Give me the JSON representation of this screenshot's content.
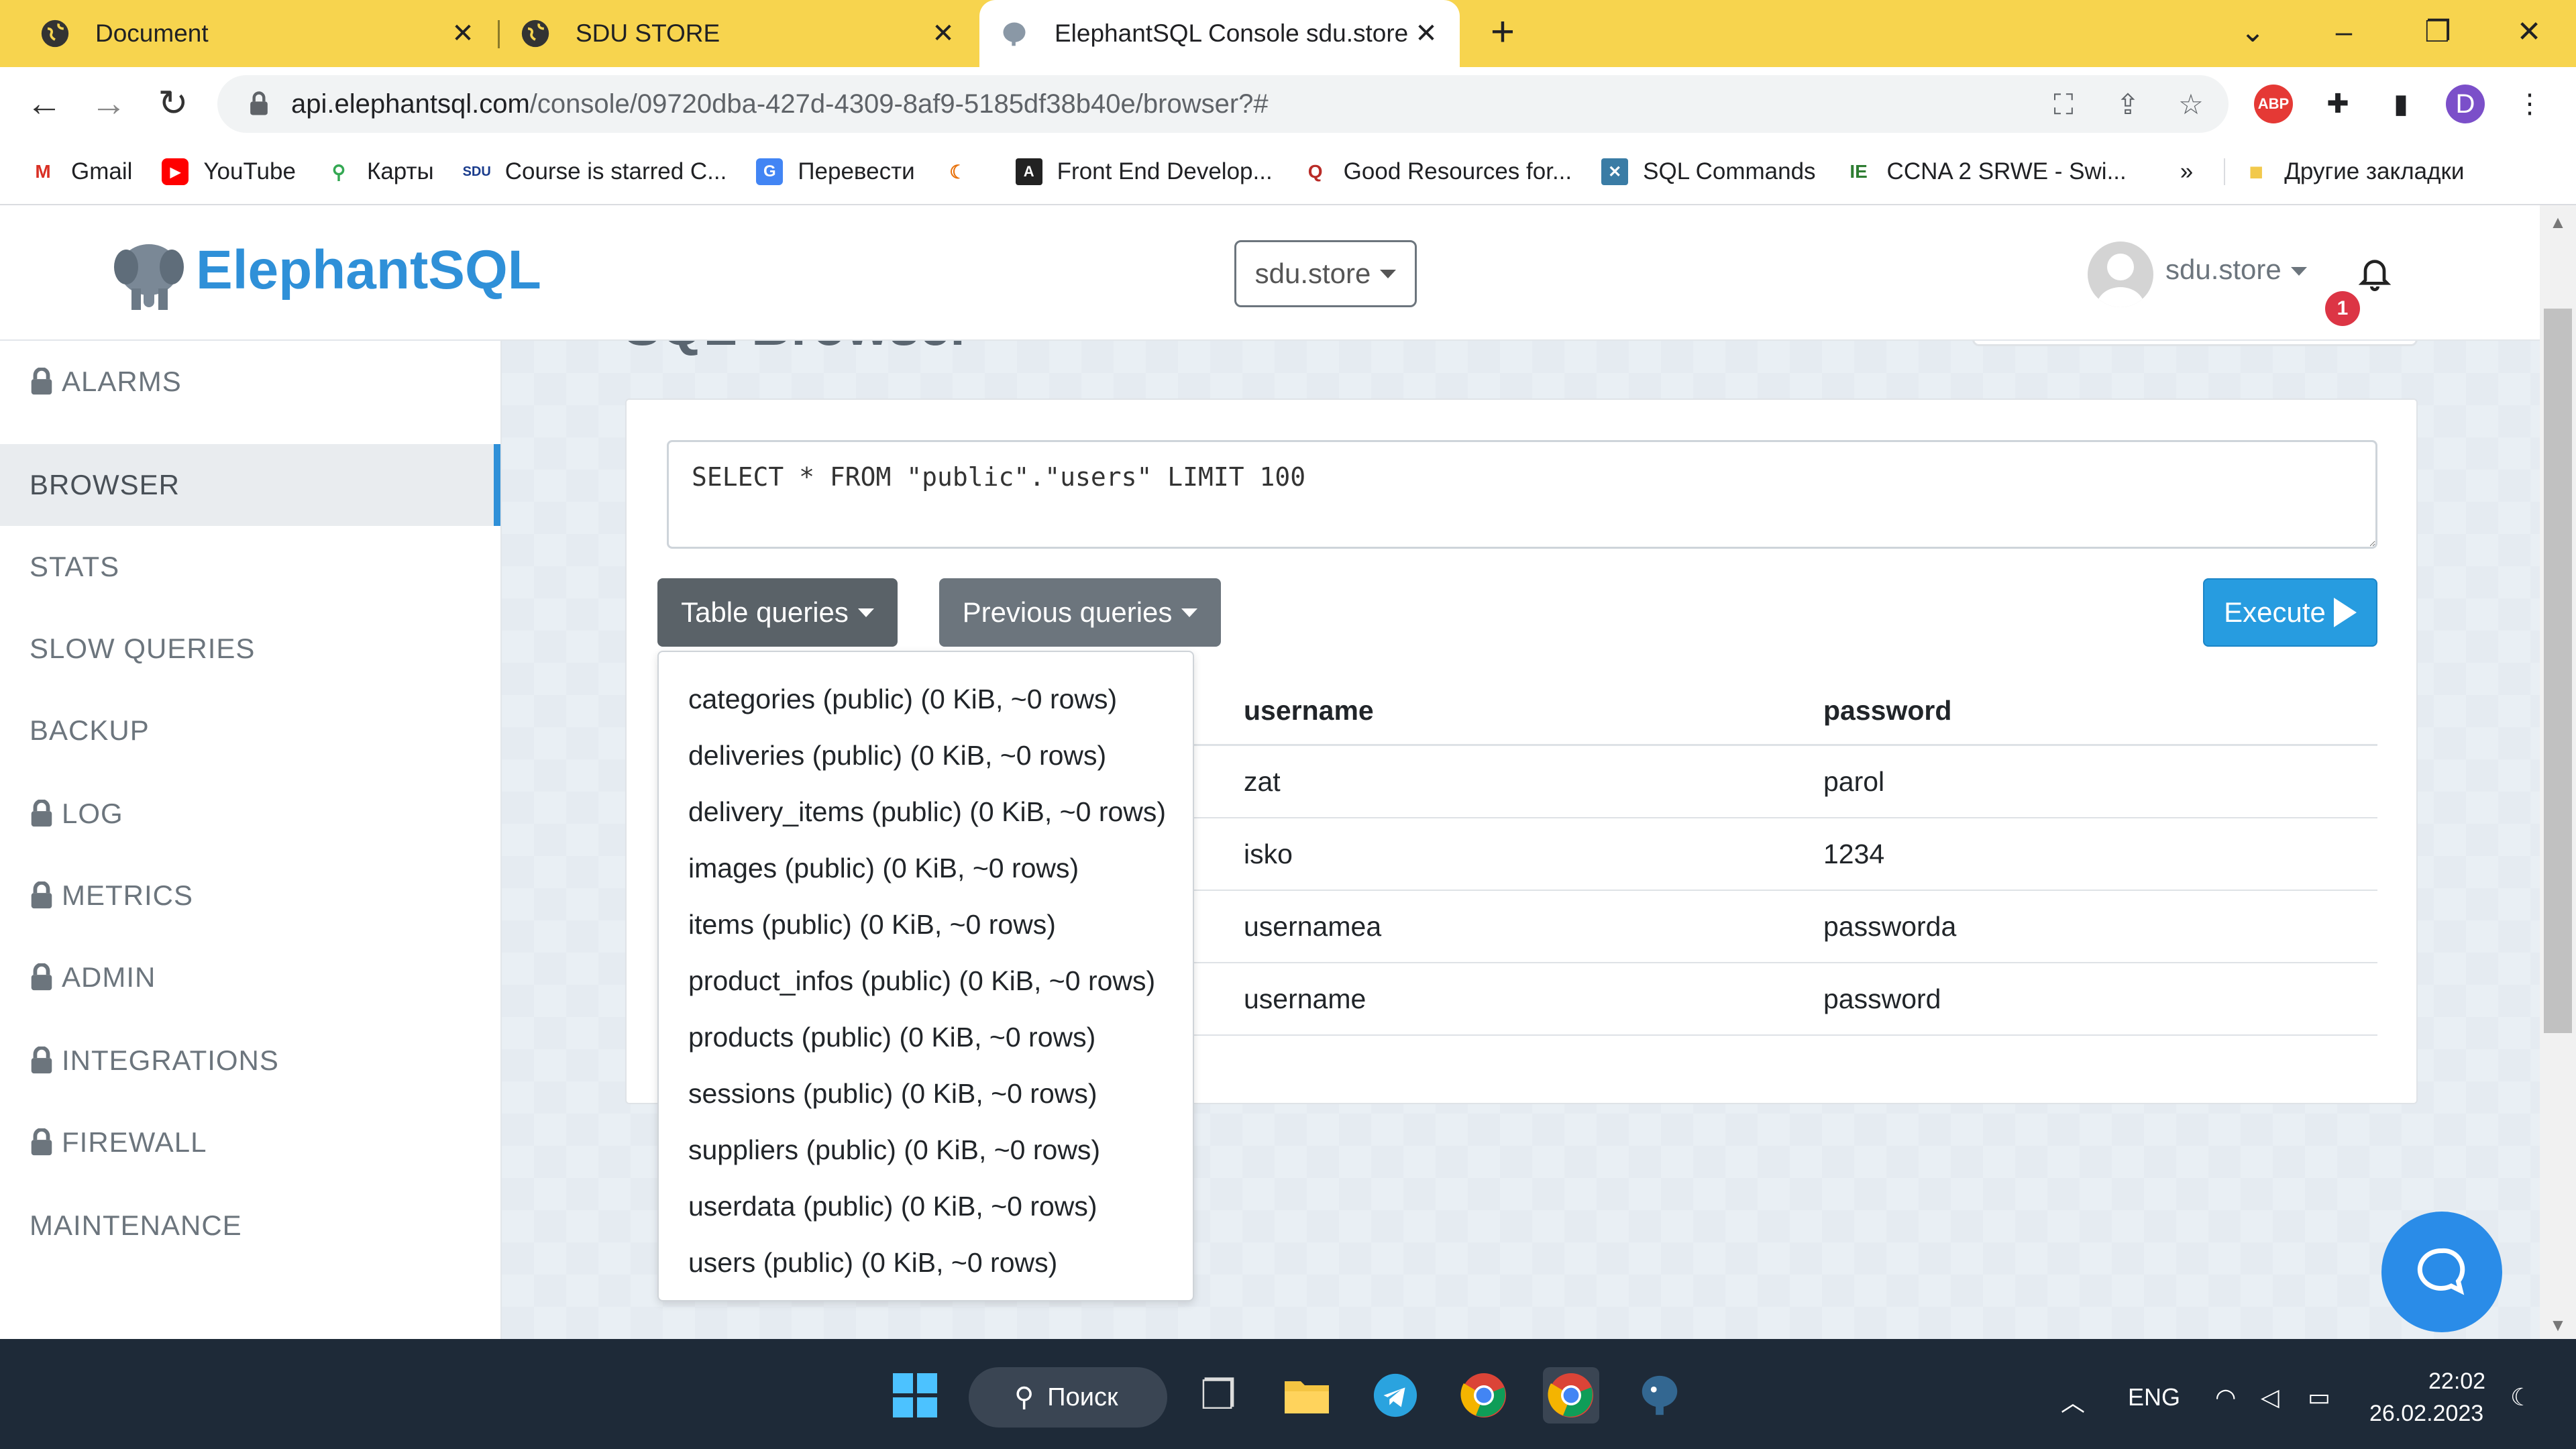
{
  "browser": {
    "tabs": [
      {
        "title": "Document",
        "active": false
      },
      {
        "title": "SDU STORE",
        "active": false
      },
      {
        "title": "ElephantSQL Console sdu.store",
        "active": true
      }
    ],
    "url_host": "api.elephantsql.com",
    "url_path": "/console/09720dba-427d-4309-8af9-5185df38b40e/browser?#",
    "profile_initial": "D",
    "bookmarks": [
      {
        "label": "Gmail",
        "icon": "gmail-icon"
      },
      {
        "label": "YouTube",
        "icon": "youtube-icon"
      },
      {
        "label": "Карты",
        "icon": "maps-icon"
      },
      {
        "label": "Course is starred C...",
        "icon": "sdu-icon"
      },
      {
        "label": "Перевести",
        "icon": "translate-icon"
      },
      {
        "label": "",
        "icon": "bookmark-icon"
      },
      {
        "label": "Front End Develop...",
        "icon": "frontend-icon"
      },
      {
        "label": "Good Resources for...",
        "icon": "quora-icon"
      },
      {
        "label": "SQL Commands",
        "icon": "sql-icon"
      },
      {
        "label": "CCNA 2 SRWE - Swi...",
        "icon": "ccna-icon"
      }
    ],
    "bookmarks_overflow": "»",
    "other_bookmarks": "Другие закладки"
  },
  "app": {
    "logo": "ElephantSQL",
    "instance": "sdu.store",
    "user": "sdu.store",
    "notifications": "1",
    "page_title": "SQL Browser"
  },
  "sidebar": {
    "items": [
      {
        "label": "ALARMS",
        "locked": true,
        "active": false
      },
      {
        "label": "BROWSER",
        "locked": false,
        "active": true
      },
      {
        "label": "STATS",
        "locked": false,
        "active": false
      },
      {
        "label": "SLOW QUERIES",
        "locked": false,
        "active": false
      },
      {
        "label": "BACKUP",
        "locked": false,
        "active": false
      },
      {
        "label": "LOG",
        "locked": true,
        "active": false
      },
      {
        "label": "METRICS",
        "locked": true,
        "active": false
      },
      {
        "label": "ADMIN",
        "locked": true,
        "active": false
      },
      {
        "label": "INTEGRATIONS",
        "locked": true,
        "active": false
      },
      {
        "label": "FIREWALL",
        "locked": true,
        "active": false
      },
      {
        "label": "MAINTENANCE",
        "locked": false,
        "active": false
      }
    ]
  },
  "browser_panel": {
    "query": "SELECT * FROM \"public\".\"users\" LIMIT 100",
    "table_queries_label": "Table queries",
    "previous_queries_label": "Previous queries",
    "execute_label": "Execute",
    "table_queries": [
      "categories (public) (0 KiB, ~0 rows)",
      "deliveries (public) (0 KiB, ~0 rows)",
      "delivery_items (public) (0 KiB, ~0 rows)",
      "images (public) (0 KiB, ~0 rows)",
      "items (public) (0 KiB, ~0 rows)",
      "product_infos (public) (0 KiB, ~0 rows)",
      "products (public) (0 KiB, ~0 rows)",
      "sessions (public) (0 KiB, ~0 rows)",
      "suppliers (public) (0 KiB, ~0 rows)",
      "userdata (public) (0 KiB, ~0 rows)",
      "users (public) (0 KiB, ~0 rows)"
    ],
    "results": {
      "columns": [
        "username",
        "password"
      ],
      "rows": [
        [
          "zat",
          "parol"
        ],
        [
          "isko",
          "1234"
        ],
        [
          "usernamea",
          "passworda"
        ],
        [
          "username",
          "password"
        ]
      ]
    }
  },
  "taskbar": {
    "search_label": "Поиск",
    "language": "ENG",
    "time": "22:02",
    "date": "26.02.2023"
  },
  "colors": {
    "tab_strip": "#f7d44e",
    "brand": "#2f90d8",
    "execute": "#279ce0",
    "badge": "#dc3545"
  }
}
